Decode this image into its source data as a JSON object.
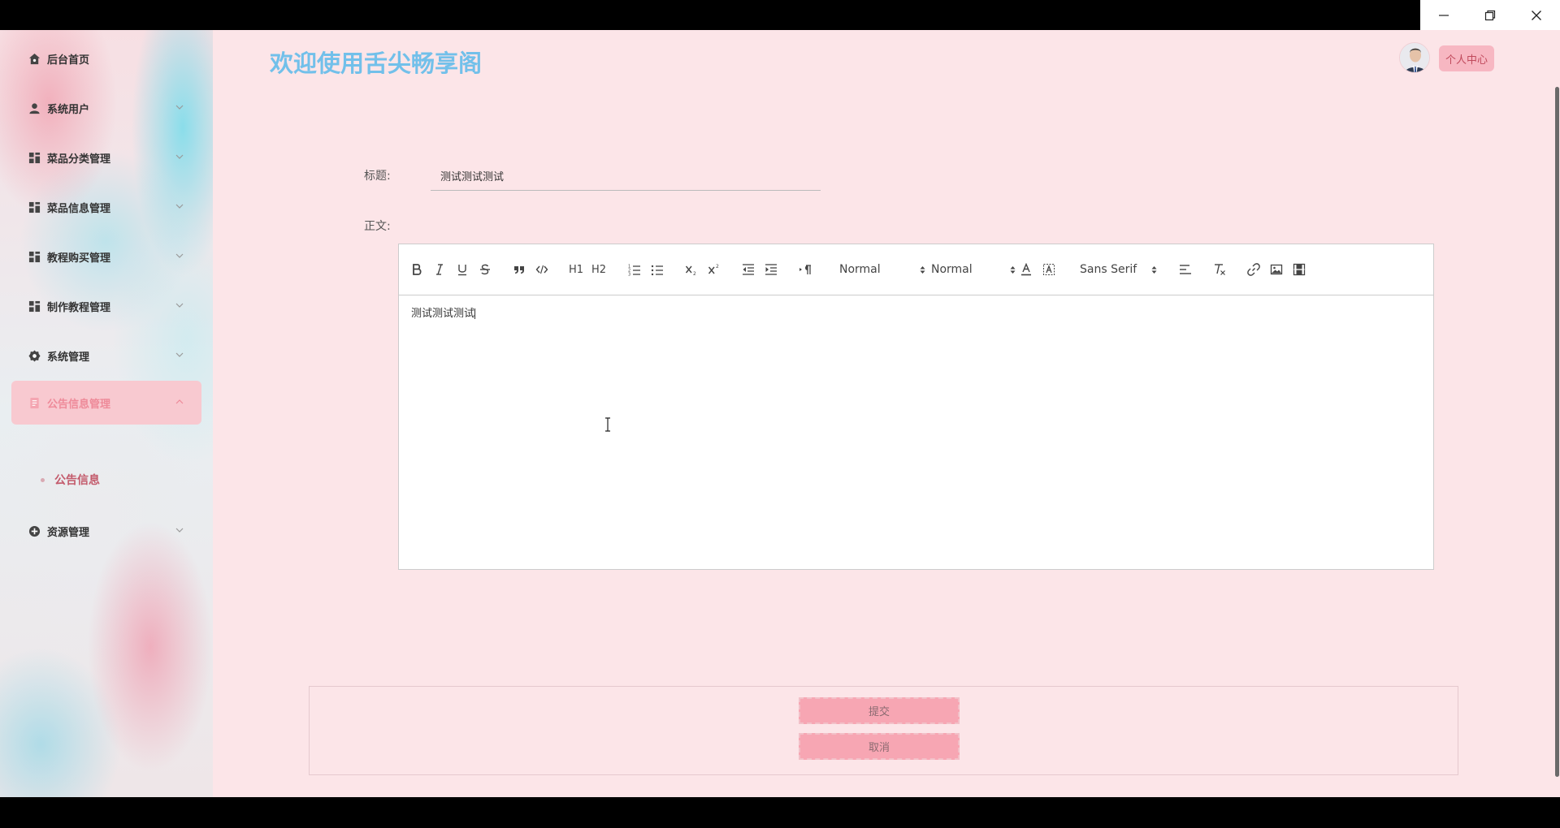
{
  "window": {
    "controls": [
      "minimize-icon",
      "restore-icon",
      "close-icon"
    ]
  },
  "header": {
    "title": "欢迎使用舌尖畅享阁",
    "profile_button": "个人中心"
  },
  "sidebar": {
    "items": [
      {
        "label": "后台首页",
        "icon": "home-icon"
      },
      {
        "label": "系统用户",
        "icon": "user-icon"
      },
      {
        "label": "菜品分类管理",
        "icon": "grid-icon"
      },
      {
        "label": "菜品信息管理",
        "icon": "grid-icon"
      },
      {
        "label": "教程购买管理",
        "icon": "grid-icon"
      },
      {
        "label": "制作教程管理",
        "icon": "grid-icon"
      },
      {
        "label": "系统管理",
        "icon": "gear-icon"
      },
      {
        "label": "公告信息管理",
        "icon": "document-icon"
      },
      {
        "label": "资源管理",
        "icon": "plus-circle-icon"
      }
    ],
    "active_submenu": "公告信息"
  },
  "form": {
    "title_label": "标题:",
    "title_value": "测试测试测试",
    "body_label": "正文:",
    "body_value": "测试测试测试"
  },
  "toolbar": {
    "header_picker": "Normal",
    "size_picker": "Normal",
    "font_picker": "Sans Serif",
    "h1": "H1",
    "h2": "H2"
  },
  "actions": {
    "submit": "提交",
    "cancel": "取消"
  },
  "colors": {
    "accent": "#f7a6b3",
    "title_blue": "#72c0ea",
    "background": "#fce5e8"
  }
}
